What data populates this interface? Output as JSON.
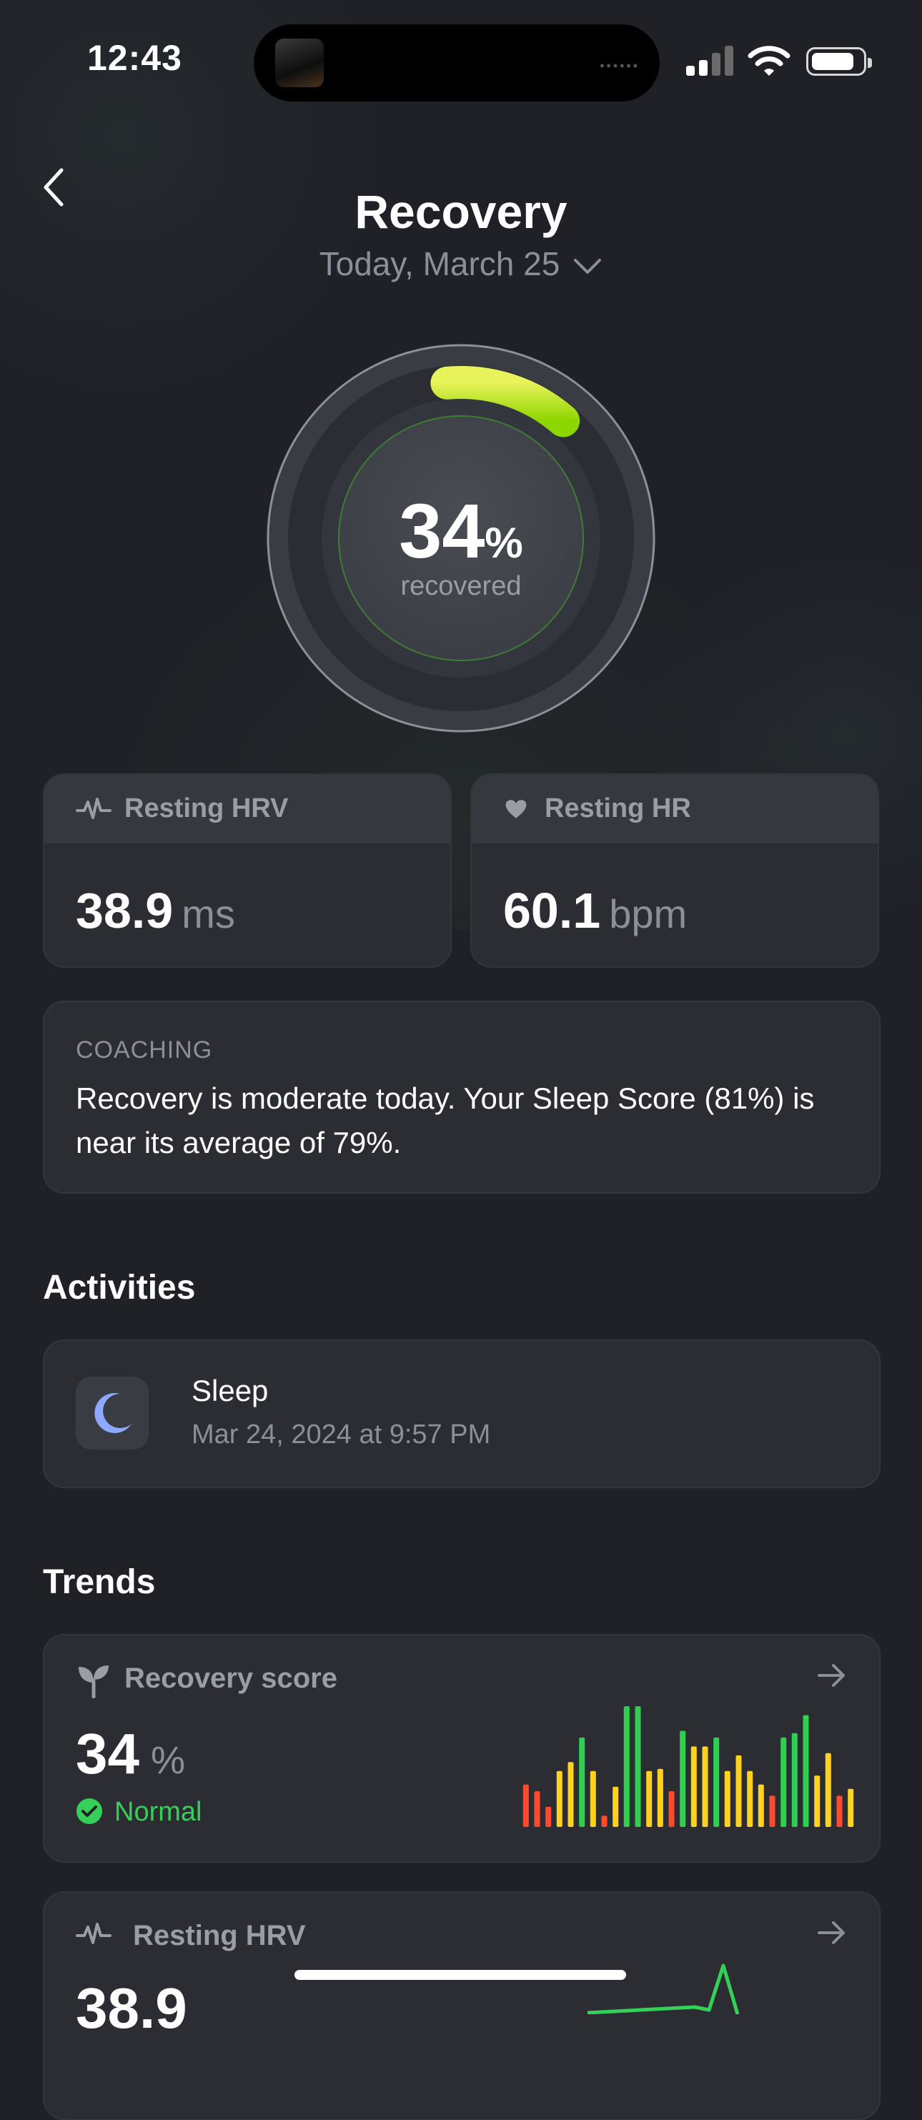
{
  "status_bar": {
    "time": "12:43"
  },
  "header": {
    "title": "Recovery",
    "date": "Today, March 25"
  },
  "recovery_ring": {
    "value": "34",
    "unit": "%",
    "label": "recovered",
    "fraction": 0.34
  },
  "metrics": [
    {
      "label": "Resting HRV",
      "value": "38.9",
      "unit": "ms",
      "icon": "pulse-icon"
    },
    {
      "label": "Resting HR",
      "value": "60.1",
      "unit": "bpm",
      "icon": "heart-icon"
    }
  ],
  "coaching": {
    "label": "COACHING",
    "text": "Recovery is moderate today. Your Sleep Score (81%) is near its average of 79%."
  },
  "activities": {
    "heading": "Activities",
    "items": [
      {
        "name": "Sleep",
        "date": "Mar 24, 2024 at 9:57 PM",
        "icon": "moon-icon"
      }
    ]
  },
  "trends": {
    "heading": "Trends",
    "cards": [
      {
        "label": "Recovery score",
        "value": "34",
        "unit": "%",
        "status": "Normal",
        "icon": "sprout-icon",
        "chart_data": {
          "type": "bar",
          "values": [
            19,
            16,
            9,
            25,
            29,
            40,
            25,
            5,
            18,
            54,
            54,
            25,
            26,
            16,
            43,
            36,
            36,
            40,
            25,
            32,
            25,
            19,
            14,
            40,
            42,
            50,
            23,
            33,
            14,
            17
          ],
          "colors": [
            "#ff4a2e",
            "#ff4a2e",
            "#ff4a2e",
            "#ffd21f",
            "#ffd21f",
            "#2fd04f",
            "#ffd21f",
            "#ff4a2e",
            "#ffd21f",
            "#2fd04f",
            "#2fd04f",
            "#ffd21f",
            "#ffd21f",
            "#ff4a2e",
            "#2fd04f",
            "#ffd21f",
            "#ffd21f",
            "#2fd04f",
            "#ffd21f",
            "#ffd21f",
            "#ffd21f",
            "#ffd21f",
            "#ff4a2e",
            "#2fd04f",
            "#2fd04f",
            "#2fd04f",
            "#ffd21f",
            "#ffd21f",
            "#ff4a2e",
            "#ffd21f"
          ],
          "ylim": [
            0,
            55
          ]
        }
      },
      {
        "label": "Resting HRV",
        "value": "38.9",
        "icon": "pulse-icon"
      }
    ]
  },
  "colors": {
    "background": "#1f2126",
    "card": "#2b2d33",
    "accent_green": "#34d058",
    "ring_start": "#e6f05a",
    "ring_end": "#8fd600"
  }
}
